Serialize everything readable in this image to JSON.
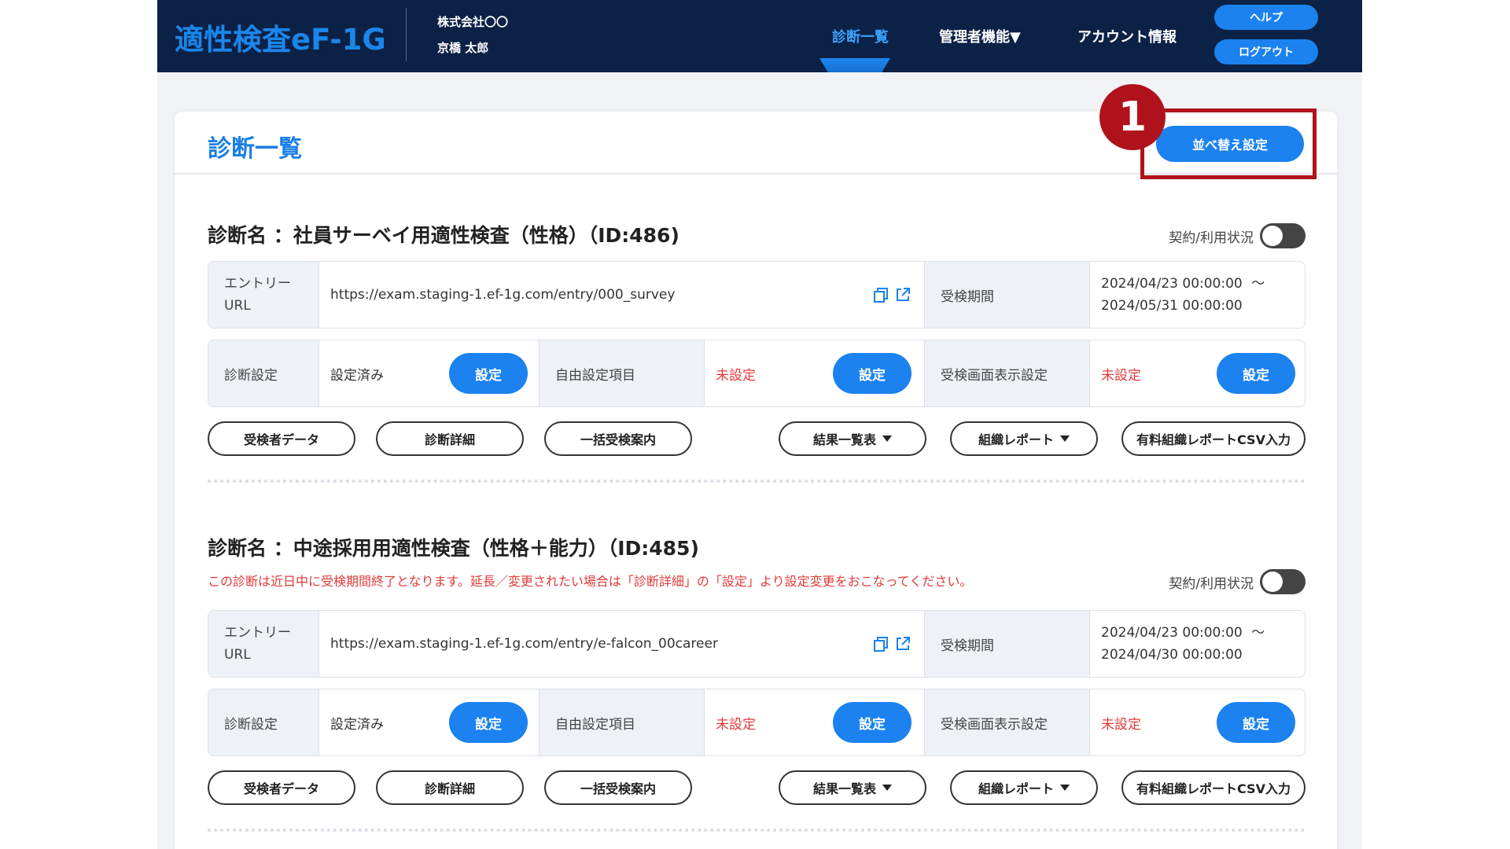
{
  "header": {
    "logo": "適性検査eF-1G",
    "company": "株式会社〇〇",
    "user": "京橋 太郎",
    "nav": [
      "診断一覧",
      "管理者機能▼",
      "アカウント情報"
    ],
    "help_label": "ヘルプ",
    "logout_label": "ログアウト"
  },
  "page": {
    "title": "診断一覧",
    "sort_label": "並べ替え設定",
    "step_number": "1"
  },
  "colors": {
    "accent": "#1b82f0",
    "header_bg": "#0c2146",
    "warning": "#e23a3a",
    "highlight": "#b0121b"
  },
  "labels": {
    "toggle": "契約/利用状況",
    "entry_url": "エントリー URL",
    "period": "受検期間",
    "diag_setting": "診断設定",
    "free_items": "自由設定項目",
    "screen_setting": "受検画面表示設定",
    "set_button": "設定",
    "configured": "設定済み",
    "not_configured": "未設定",
    "tilde": "〜"
  },
  "actions": [
    "受検者データ",
    "診断詳細",
    "一括受検案内",
    "結果一覧表",
    "組織レポート",
    "有料組織レポートCSV入力"
  ],
  "diagnoses": [
    {
      "title": "診断名 ：社員サーベイ用適性検査（性格）（ID:486)",
      "warning": "",
      "url": "https://exam.staging-1.ef-1g.com/entry/000_survey",
      "period_start": "2024/04/23 00:00:00",
      "period_end": "2024/05/31 00:00:00"
    },
    {
      "title": "診断名 ：中途採用用適性検査（性格＋能力）（ID:485)",
      "warning": "この診断は近日中に受検期間終了となります。延長／変更されたい場合は「診断詳細」の「設定」より設定変更をおこなってください。",
      "url": "https://exam.staging-1.ef-1g.com/entry/e-falcon_00career",
      "period_start": "2024/04/23 00:00:00",
      "period_end": "2024/04/30 00:00:00"
    }
  ]
}
